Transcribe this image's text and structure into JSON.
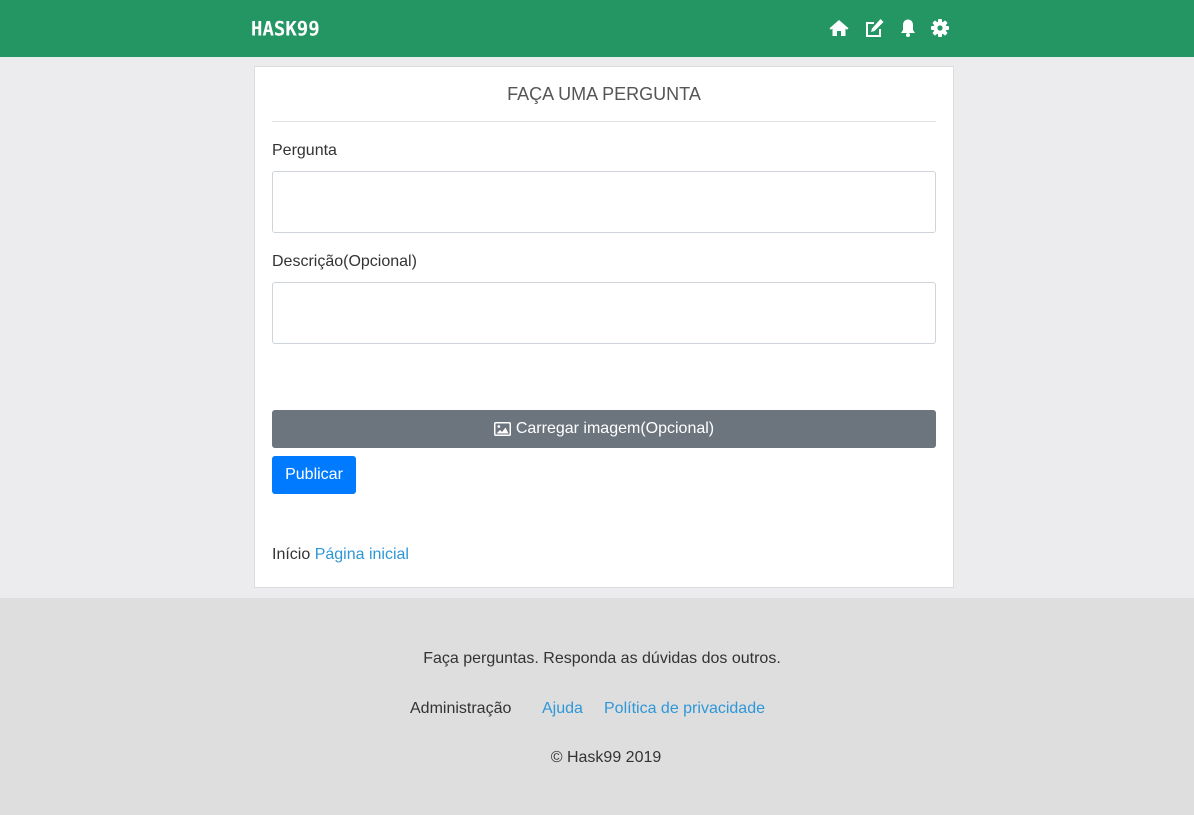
{
  "header": {
    "brand": "HASK99",
    "icons": [
      "home-icon",
      "edit-icon",
      "bell-icon",
      "gear-icon"
    ]
  },
  "form": {
    "title": "FAÇA UMA PERGUNTA",
    "question_label": "Pergunta",
    "question_value": "",
    "description_label": "Descrição(Opcional)",
    "description_value": "",
    "upload_label": "Carregar imagem(Opcional)",
    "publish_label": "Publicar"
  },
  "breadcrumb": {
    "label": "Início",
    "link": "Página inicial"
  },
  "footer": {
    "tagline": "Faça perguntas. Responda as dúvidas dos outros.",
    "admin": "Administração",
    "help": "Ajuda",
    "privacy": "Política de privacidade",
    "copyright": "© Hask99 2019"
  },
  "colors": {
    "navbar": "#239664",
    "primary": "#007bff",
    "secondary": "#6c757d",
    "link": "#2e97d8"
  }
}
